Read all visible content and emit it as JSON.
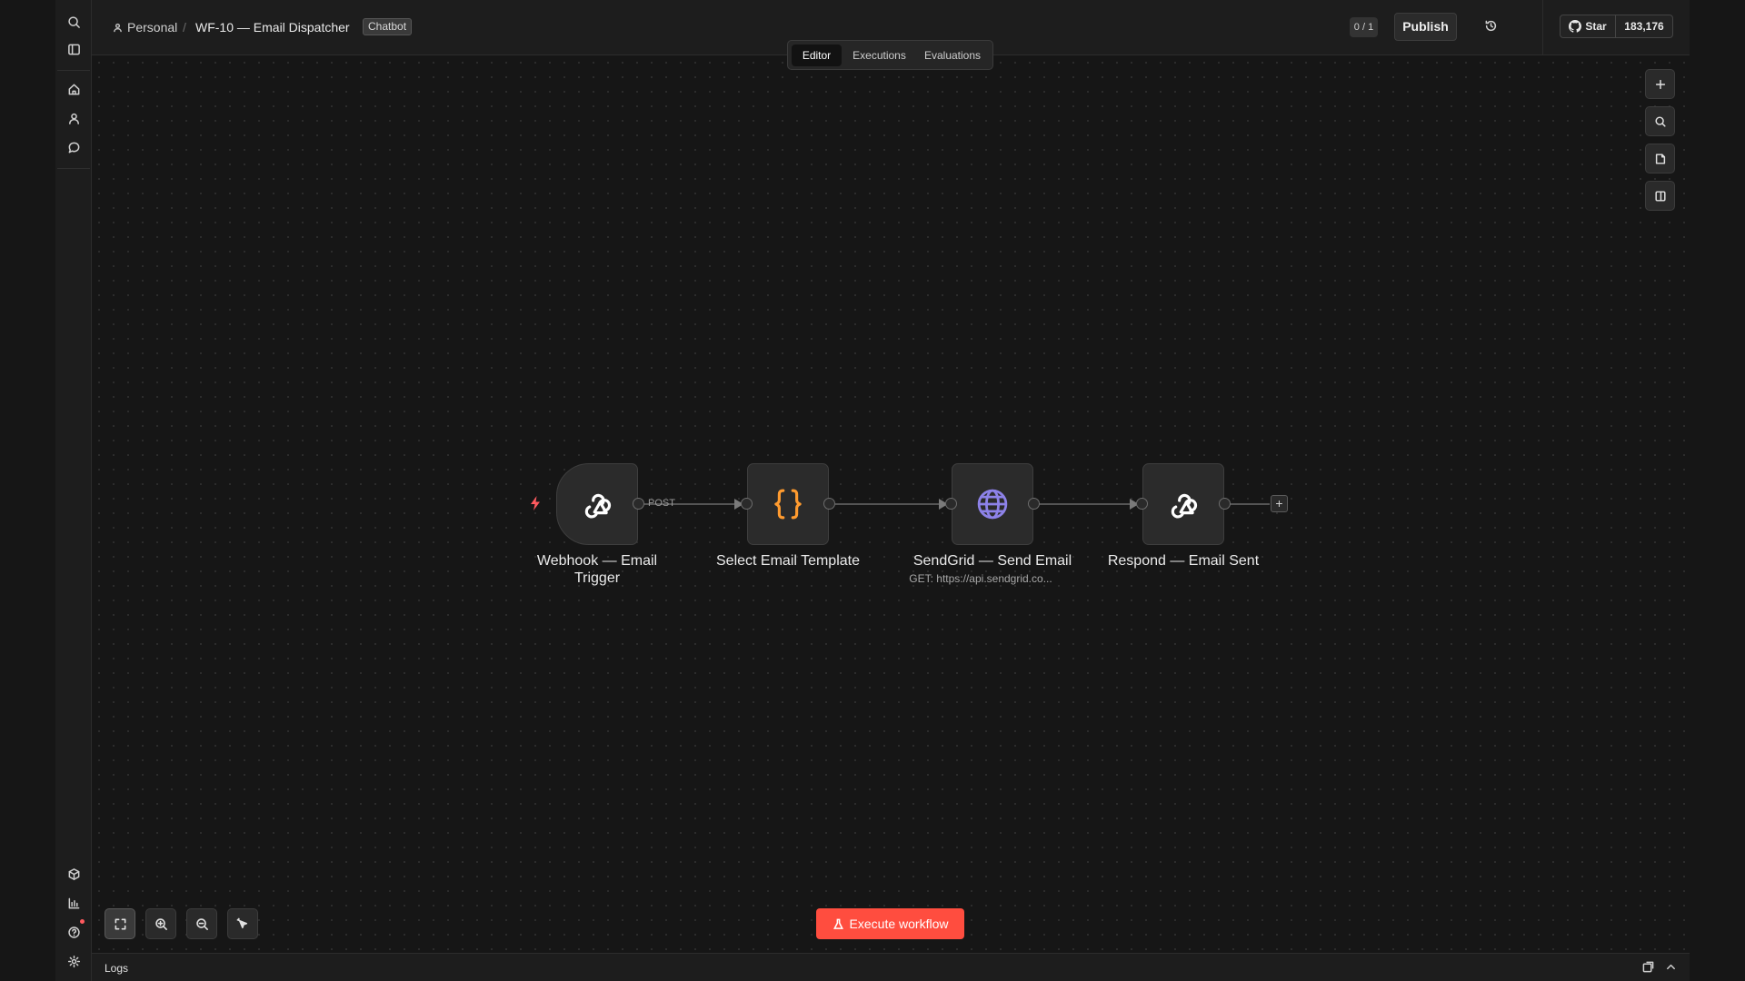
{
  "header": {
    "breadcrumb_personal": "Personal",
    "breadcrumb_separator": "/",
    "workflow_name": "WF-10 — Email Dispatcher",
    "tag": "Chatbot",
    "counter": "0 / 1",
    "publish_label": "Publish",
    "github_star_label": "Star",
    "github_star_count": "183,176"
  },
  "tabs": {
    "editor": "Editor",
    "executions": "Executions",
    "evaluations": "Evaluations"
  },
  "nodes": [
    {
      "label": "Webhook — Email Trigger",
      "icon": "webhook-icon"
    },
    {
      "label": "Select Email Template",
      "icon": "braces-icon"
    },
    {
      "label": "SendGrid — Send Email",
      "subtitle": "GET: https://api.sendgrid.co...",
      "icon": "globe-icon"
    },
    {
      "label": "Respond — Email Sent",
      "icon": "webhook-icon"
    }
  ],
  "edge_label": "POST",
  "add_node": "+",
  "execute_label": "Execute workflow",
  "logs_title": "Logs",
  "colors": {
    "accent": "#ff4d3f",
    "braces": "#ff9b2f",
    "globe": "#8d82e8",
    "trigger_bolt": "#ff5a5f"
  }
}
